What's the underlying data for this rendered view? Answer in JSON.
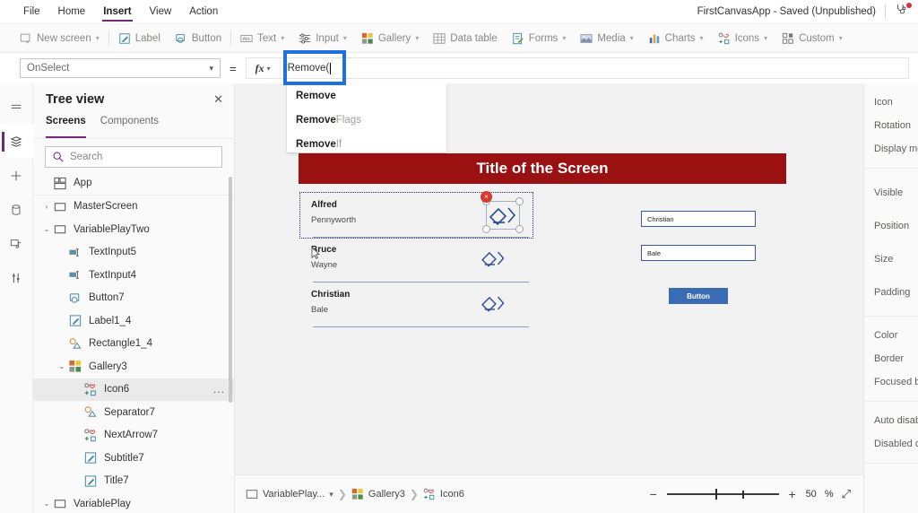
{
  "menubar": {
    "items": [
      {
        "label": "File",
        "active": false
      },
      {
        "label": "Home",
        "active": false
      },
      {
        "label": "Insert",
        "active": true
      },
      {
        "label": "View",
        "active": false
      },
      {
        "label": "Action",
        "active": false
      }
    ],
    "app_status": "FirstCanvasApp - Saved (Unpublished)",
    "health_icon": "stethoscope-icon"
  },
  "ribbon": {
    "items": [
      {
        "label": "New screen",
        "icon": "new-screen-icon",
        "caret": true
      },
      {
        "label": "Label",
        "icon": "label-icon",
        "caret": false
      },
      {
        "label": "Button",
        "icon": "button-icon",
        "caret": false
      },
      {
        "label": "Text",
        "icon": "text-icon",
        "caret": true
      },
      {
        "label": "Input",
        "icon": "input-icon",
        "caret": true
      },
      {
        "label": "Gallery",
        "icon": "gallery-icon",
        "caret": true
      },
      {
        "label": "Data table",
        "icon": "data-table-icon",
        "caret": false
      },
      {
        "label": "Forms",
        "icon": "forms-icon",
        "caret": true
      },
      {
        "label": "Media",
        "icon": "media-icon",
        "caret": true
      },
      {
        "label": "Charts",
        "icon": "charts-icon",
        "caret": true
      },
      {
        "label": "Icons",
        "icon": "icons-icon",
        "caret": true
      },
      {
        "label": "Custom",
        "icon": "custom-icon",
        "caret": true
      }
    ]
  },
  "formula_bar": {
    "property": "OnSelect",
    "equals": "=",
    "fx_label": "fx",
    "value": "Remove(",
    "autocomplete": [
      {
        "bold": "Remove",
        "rest": ""
      },
      {
        "bold": "Remove",
        "rest": "Flags"
      },
      {
        "bold": "Remove",
        "rest": "If"
      }
    ]
  },
  "annotation": {
    "color": "#1f6fe0",
    "target": "formula-input"
  },
  "rail": {
    "items": [
      {
        "name": "hamburger-icon",
        "label": "Menu",
        "selected": false
      },
      {
        "name": "tree-view-icon",
        "label": "Tree view",
        "selected": true
      },
      {
        "name": "insert-icon",
        "label": "Insert",
        "selected": false
      },
      {
        "name": "data-icon",
        "label": "Data",
        "selected": false
      },
      {
        "name": "media-icon",
        "label": "Media",
        "selected": false
      },
      {
        "name": "variables-icon",
        "label": "Variables",
        "selected": false
      }
    ]
  },
  "tree_view": {
    "title": "Tree view",
    "close_icon": "close-icon",
    "tabs": [
      {
        "label": "Screens",
        "active": true
      },
      {
        "label": "Components",
        "active": false
      }
    ],
    "search_placeholder": "Search",
    "search_icon": "search-icon",
    "nodes": [
      {
        "label": "App",
        "icon": "app-icon",
        "indent": 0,
        "chevron": "",
        "selected": false,
        "separator": true
      },
      {
        "label": "MasterScreen",
        "icon": "screen-icon",
        "indent": 0,
        "chevron": "collapsed",
        "selected": false,
        "separator": false
      },
      {
        "label": "VariablePlayTwo",
        "icon": "screen-icon",
        "indent": 0,
        "chevron": "expanded",
        "selected": false,
        "separator": false
      },
      {
        "label": "TextInput5",
        "icon": "text-input-icon",
        "indent": 1,
        "chevron": "",
        "selected": false,
        "separator": false
      },
      {
        "label": "TextInput4",
        "icon": "text-input-icon",
        "indent": 1,
        "chevron": "",
        "selected": false,
        "separator": false
      },
      {
        "label": "Button7",
        "icon": "button-icon",
        "indent": 1,
        "chevron": "",
        "selected": false,
        "separator": false
      },
      {
        "label": "Label1_4",
        "icon": "label-icon",
        "indent": 1,
        "chevron": "",
        "selected": false,
        "separator": false
      },
      {
        "label": "Rectangle1_4",
        "icon": "shape-icon",
        "indent": 1,
        "chevron": "",
        "selected": false,
        "separator": false
      },
      {
        "label": "Gallery3",
        "icon": "gallery-icon",
        "indent": 1,
        "chevron": "expanded",
        "selected": false,
        "separator": false
      },
      {
        "label": "Icon6",
        "icon": "icons-icon",
        "indent": 2,
        "chevron": "",
        "selected": true,
        "separator": false,
        "overflow": "..."
      },
      {
        "label": "Separator7",
        "icon": "shape-icon",
        "indent": 2,
        "chevron": "",
        "selected": false,
        "separator": false
      },
      {
        "label": "NextArrow7",
        "icon": "icons-icon",
        "indent": 2,
        "chevron": "",
        "selected": false,
        "separator": false
      },
      {
        "label": "Subtitle7",
        "icon": "label-icon",
        "indent": 2,
        "chevron": "",
        "selected": false,
        "separator": false
      },
      {
        "label": "Title7",
        "icon": "label-icon",
        "indent": 2,
        "chevron": "",
        "selected": false,
        "separator": false
      },
      {
        "label": "VariablePlay",
        "icon": "screen-icon",
        "indent": 0,
        "chevron": "expanded",
        "selected": false,
        "separator": false
      }
    ]
  },
  "canvas": {
    "screen_title": "Title of the Screen",
    "header_color": "#9b1111",
    "gallery": {
      "rows": [
        {
          "title": "Alfred",
          "subtitle": "Pennyworth",
          "selected": true,
          "arrow_icon": "eraser-next-icon"
        },
        {
          "title": "Bruce",
          "subtitle": "Wayne",
          "selected": false,
          "arrow_icon": "eraser-next-icon"
        },
        {
          "title": "Christian",
          "subtitle": "Bale",
          "selected": false,
          "arrow_icon": "eraser-next-icon"
        }
      ],
      "delete_badge": "×"
    },
    "text_inputs": [
      {
        "value": "Christian"
      },
      {
        "value": "Bale"
      }
    ],
    "button_label": "Button",
    "cursor_icon": "mouse-pointer-icon"
  },
  "properties_panel": {
    "groups": [
      [
        "Icon",
        "Rotation",
        "Display mod"
      ],
      [
        "Visible",
        "Position",
        "Size",
        "Padding"
      ],
      [
        "Color",
        "Border",
        "Focused bor"
      ],
      [
        "Auto disable",
        "Disabled col"
      ]
    ]
  },
  "bottom_bar": {
    "breadcrumb": [
      {
        "label": "VariablePlay...",
        "icon": "screen-icon",
        "caret": true
      },
      {
        "label": "Gallery3",
        "icon": "gallery-icon",
        "caret": false
      },
      {
        "label": "Icon6",
        "icon": "icons-icon",
        "caret": false
      }
    ],
    "zoom_minus": "−",
    "zoom_plus": "+",
    "zoom_value": "50",
    "zoom_unit": "%",
    "expand_icon": "expand-icon"
  }
}
